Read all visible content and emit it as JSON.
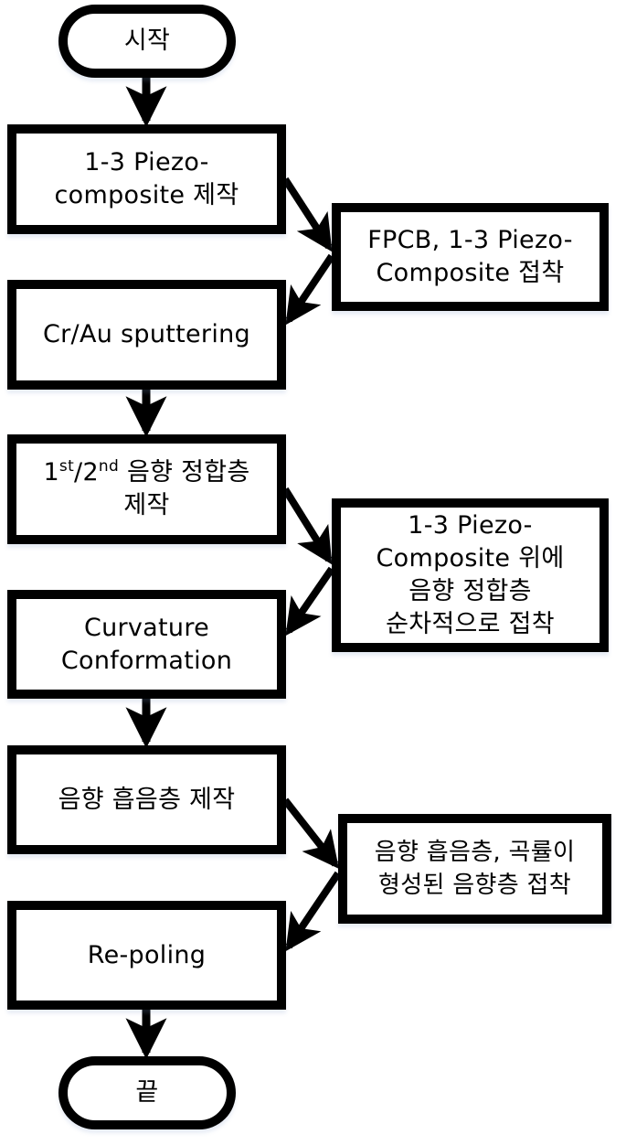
{
  "flowchart": {
    "start": "시작",
    "end": "끝",
    "main_steps": [
      "1-3 Piezo-\ncomposite 제작",
      "Cr/Au sputtering",
      "음향 정합층\n제작",
      "Curvature\nConformation",
      "음향 흡음층 제작",
      "Re-poling"
    ],
    "step3_prefix": {
      "n1": "1",
      "s1": "st",
      "mid": "/2",
      "s2": "nd",
      "rest": " 음향 정합층"
    },
    "side_steps": [
      "FPCB, 1-3 Piezo-\nComposite 접착",
      "1-3 Piezo-\nComposite 위에\n음향 정합층\n순차적으로 접착",
      "음향 흡음층, 곡률이\n형성된 음향층 접착"
    ],
    "colors": {
      "stroke": "#000000",
      "fill": "#ffffff"
    }
  }
}
